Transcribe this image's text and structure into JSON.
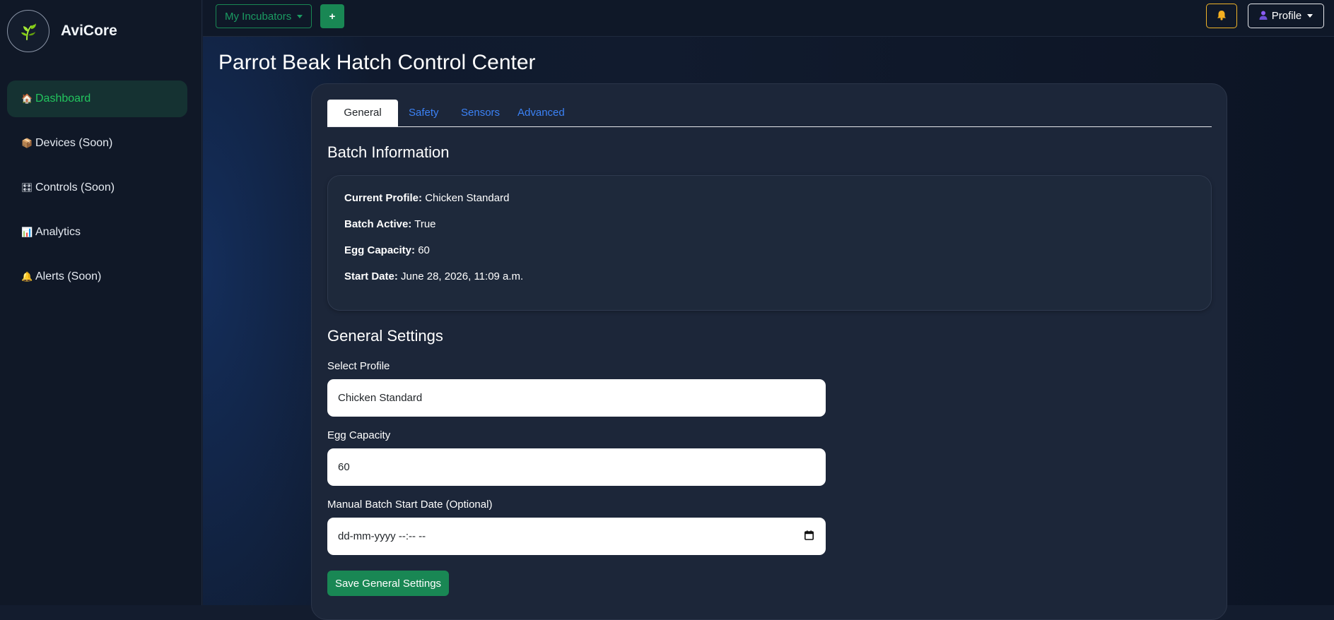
{
  "brand": {
    "name": "AviCore"
  },
  "sidebar": {
    "items": [
      {
        "label": "Dashboard",
        "icon": "house-icon",
        "glyph": "🏠"
      },
      {
        "label": "Devices (Soon)",
        "icon": "package-icon",
        "glyph": "📦"
      },
      {
        "label": "Controls (Soon)",
        "icon": "control-knobs-icon",
        "glyph": "🎛"
      },
      {
        "label": "Analytics",
        "icon": "bar-chart-icon",
        "glyph": "📊"
      },
      {
        "label": "Alerts (Soon)",
        "icon": "bell-icon",
        "glyph": "🔔"
      }
    ]
  },
  "topbar": {
    "incubators_label": "My Incubators",
    "add_label": "+",
    "profile_label": "Profile"
  },
  "page": {
    "title": "Parrot Beak Hatch Control Center"
  },
  "tabs": [
    "General",
    "Safety",
    "Sensors",
    "Advanced"
  ],
  "batch": {
    "heading": "Batch Information",
    "current_profile_label": "Current Profile:",
    "current_profile_value": "Chicken Standard",
    "batch_active_label": "Batch Active:",
    "batch_active_value": "True",
    "egg_capacity_label": "Egg Capacity:",
    "egg_capacity_value": "60",
    "start_date_label": "Start Date:",
    "start_date_value": "June 28, 2026, 11:09 a.m."
  },
  "general": {
    "heading": "General Settings",
    "select_profile_label": "Select Profile",
    "select_profile_value": "Chicken Standard",
    "egg_capacity_label": "Egg Capacity",
    "egg_capacity_value": "60",
    "start_date_label": "Manual Batch Start Date (Optional)",
    "start_date_placeholder": "dd-mm-yyyy --:-- --",
    "save_label": "Save General Settings"
  },
  "colors": {
    "accent_green": "#198754",
    "active_nav_text": "#22c55e",
    "link_blue": "#3b82f6",
    "bell_border": "#f0b429"
  }
}
